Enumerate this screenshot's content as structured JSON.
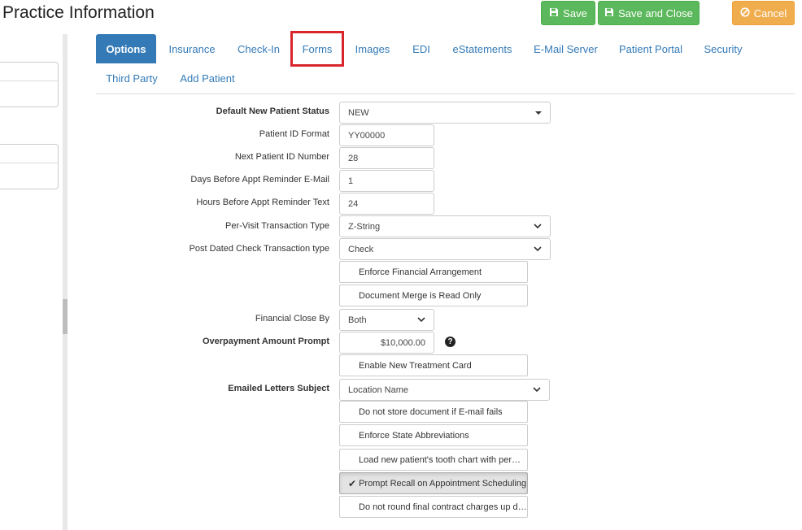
{
  "header": {
    "title": "Practice Information",
    "save_label": "Save",
    "save_close_label": "Save and Close",
    "cancel_label": "Cancel"
  },
  "tabs": [
    {
      "label": "Options",
      "active": true
    },
    {
      "label": "Insurance"
    },
    {
      "label": "Check-In"
    },
    {
      "label": "Forms",
      "highlighted": true
    },
    {
      "label": "Images"
    },
    {
      "label": "EDI"
    },
    {
      "label": "eStatements"
    },
    {
      "label": "E-Mail Server"
    },
    {
      "label": "Patient Portal"
    },
    {
      "label": "Security"
    },
    {
      "label": "Third Party"
    },
    {
      "label": "Add Patient"
    }
  ],
  "form": {
    "default_status_label": "Default New Patient Status",
    "default_status_value": "NEW",
    "patient_id_format_label": "Patient ID Format",
    "patient_id_format_value": "YY00000",
    "next_patient_id_label": "Next Patient ID Number",
    "next_patient_id_value": "28",
    "days_reminder_label": "Days Before Appt Reminder E-Mail",
    "days_reminder_value": "1",
    "hours_reminder_label": "Hours Before Appt Reminder Text",
    "hours_reminder_value": "24",
    "per_visit_label": "Per-Visit Transaction Type",
    "per_visit_value": "Z-String",
    "post_dated_label": "Post Dated Check Transaction type",
    "post_dated_value": "Check",
    "enforce_financial": "Enforce Financial Arrangement",
    "doc_merge_readonly": "Document Merge is Read Only",
    "financial_close_label": "Financial Close By",
    "financial_close_value": "Both",
    "overpayment_label": "Overpayment Amount Prompt",
    "overpayment_value": "$10,000.00",
    "enable_treatment_card": "Enable New Treatment Card",
    "emailed_subject_label": "Emailed Letters Subject",
    "emailed_subject_value": "Location Name",
    "no_store_doc": "Do not store document if E-mail fails",
    "enforce_state_abbr": "Enforce State Abbreviations",
    "load_tooth_chart": "Load new patient's tooth chart with per…",
    "prompt_recall": "Prompt Recall on Appointment Scheduling",
    "no_round_charges": "Do not round final contract charges up d…"
  },
  "colors": {
    "accent": "#337ab7",
    "success": "#5cb85c",
    "warning": "#f0ad4e",
    "highlight": "#d9262b"
  }
}
